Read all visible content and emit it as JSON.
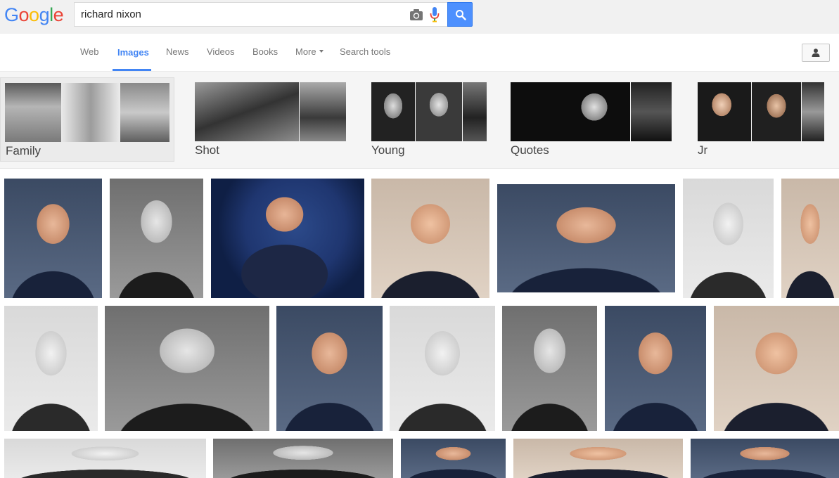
{
  "logo": {
    "letters": [
      "G",
      "o",
      "o",
      "g",
      "l",
      "e"
    ],
    "colors": [
      "#4285f4",
      "#ea4335",
      "#fbbc05",
      "#4285f4",
      "#34a853",
      "#ea4335"
    ]
  },
  "search": {
    "query": "richard nixon",
    "camera_icon": "camera-icon",
    "mic_icon": "microphone-icon",
    "button_icon": "search-icon"
  },
  "nav": {
    "items": [
      "Web",
      "Images",
      "News",
      "Videos",
      "Books",
      "More",
      "Search tools"
    ],
    "active": "Images",
    "accent": "#4285f4"
  },
  "account": {
    "icon": "account-icon"
  },
  "related": [
    "Family",
    "Shot",
    "Young",
    "Quotes",
    "Jr"
  ],
  "results": {
    "count_visible": 21
  }
}
